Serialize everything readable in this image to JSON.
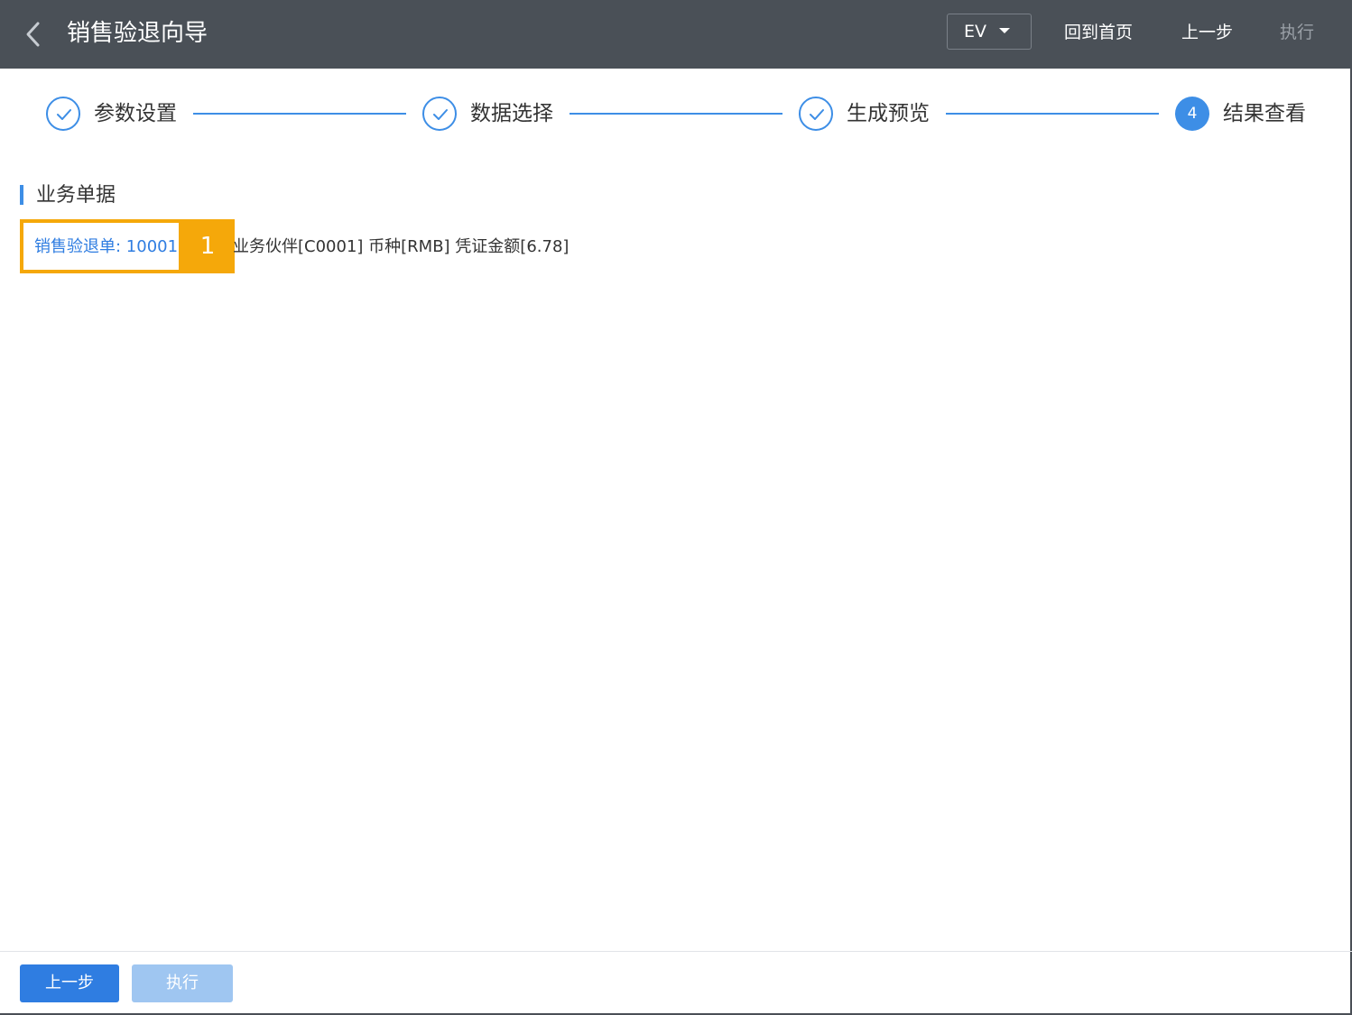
{
  "header": {
    "title": "销售验退向导",
    "env_select": "EV",
    "links": {
      "home": "回到首页",
      "prev": "上一步",
      "execute": "执行"
    }
  },
  "steps": [
    {
      "label": "参数设置",
      "status": "done"
    },
    {
      "label": "数据选择",
      "status": "done"
    },
    {
      "label": "生成预览",
      "status": "done"
    },
    {
      "label": "结果查看",
      "status": "active",
      "number": "4"
    }
  ],
  "section": {
    "title": "业务单据",
    "documents": [
      {
        "link_text": "销售验退单: 10001",
        "badge": "1",
        "detail": "业务伙伴[C0001] 币种[RMB] 凭证金额[6.78]"
      }
    ]
  },
  "footer": {
    "prev_label": "上一步",
    "execute_label": "执行"
  },
  "colors": {
    "header_bg": "#4a5057",
    "accent": "#3d8ee6",
    "highlight": "#f5a80a",
    "disabled_button": "#9fc6f1"
  }
}
